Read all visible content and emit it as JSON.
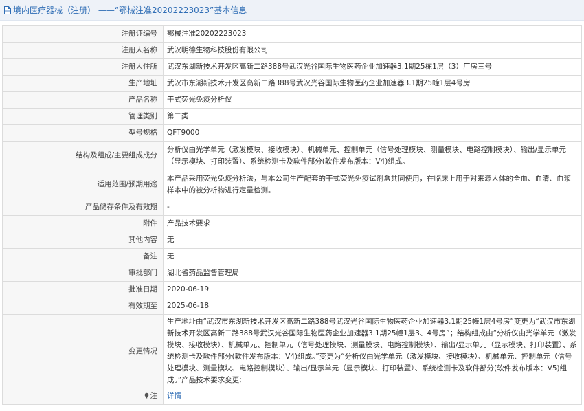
{
  "header": {
    "title": "境内医疗器械（注册） ——“鄂械注准20202223023”基本信息"
  },
  "rows": [
    {
      "label": "注册证编号",
      "value": "鄂械注准20202223023"
    },
    {
      "label": "注册人名称",
      "value": "武汉明德生物科技股份有限公司"
    },
    {
      "label": "注册人住所",
      "value": "武汉东湖新技术开发区高新二路388号武汉光谷国际生物医药企业加速器3.1期25栋1层（3）厂房三号"
    },
    {
      "label": "生产地址",
      "value": "武汉市东湖新技术开发区高新二路388号武汉光谷国际生物医药企业加速器3.1期25幢1层4号房"
    },
    {
      "label": "产品名称",
      "value": "干式荧光免疫分析仪"
    },
    {
      "label": "管理类别",
      "value": "第二类"
    },
    {
      "label": "型号规格",
      "value": "QFT9000"
    },
    {
      "label": "结构及组成/主要组成成分",
      "value": "分析仪由光学单元（激发模块、接收模块）、机械单元、控制单元（信号处理模块、测量模块、电路控制模块）、输出/显示单元（显示模块、打印装置）、系统检测卡及软件部分(软件发布版本：V4)组成。"
    },
    {
      "label": "适用范围/预期用途",
      "value": "本产品采用荧光免疫分析法，与本公司生产配套的干式荧光免疫试剂盒共同使用，在临床上用于对来源人体的全血、血清、血浆样本中的被分析物进行定量检测。"
    },
    {
      "label": "产品储存条件及有效期",
      "value": "-"
    },
    {
      "label": "附件",
      "value": "产品技术要求"
    },
    {
      "label": "其他内容",
      "value": "无"
    },
    {
      "label": "备注",
      "value": "无"
    },
    {
      "label": "审批部门",
      "value": "湖北省药品监督管理局"
    },
    {
      "label": "批准日期",
      "value": "2020-06-19"
    },
    {
      "label": "有效期至",
      "value": "2025-06-18"
    },
    {
      "label": "变更情况",
      "value": "生产地址由“武汉市东湖新技术开发区高新二路388号武汉光谷国际生物医药企业加速器3.1期25幢1层4号房”变更为“武汉市东湖新技术开发区高新二路388号武汉光谷国际生物医药企业加速器3.1期25幢1层3、4号房”；结构组成由“分析仪由光学单元（激发模块、接收模块）、机械单元、控制单元（信号处理模块、测量模块、电路控制模块）、输出/显示单元（显示模块、打印装置）、系统检测卡及软件部分(软件发布版本：V4)组成。”变更为“分析仪由光学单元（激发模块、接收模块）、机械单元、控制单元（信号处理模块、测量模块、电路控制模块）、输出/显示单元（显示模块、打印装置）、系统检测卡及软件部分(软件发布版本：V5)组成。”产品技术要求变更;"
    }
  ],
  "note": {
    "label": "注",
    "link": "详情"
  },
  "colors": {
    "accent": "#2f6db5",
    "label_bg": "#f7f7f7",
    "border": "#dcdcdc"
  }
}
